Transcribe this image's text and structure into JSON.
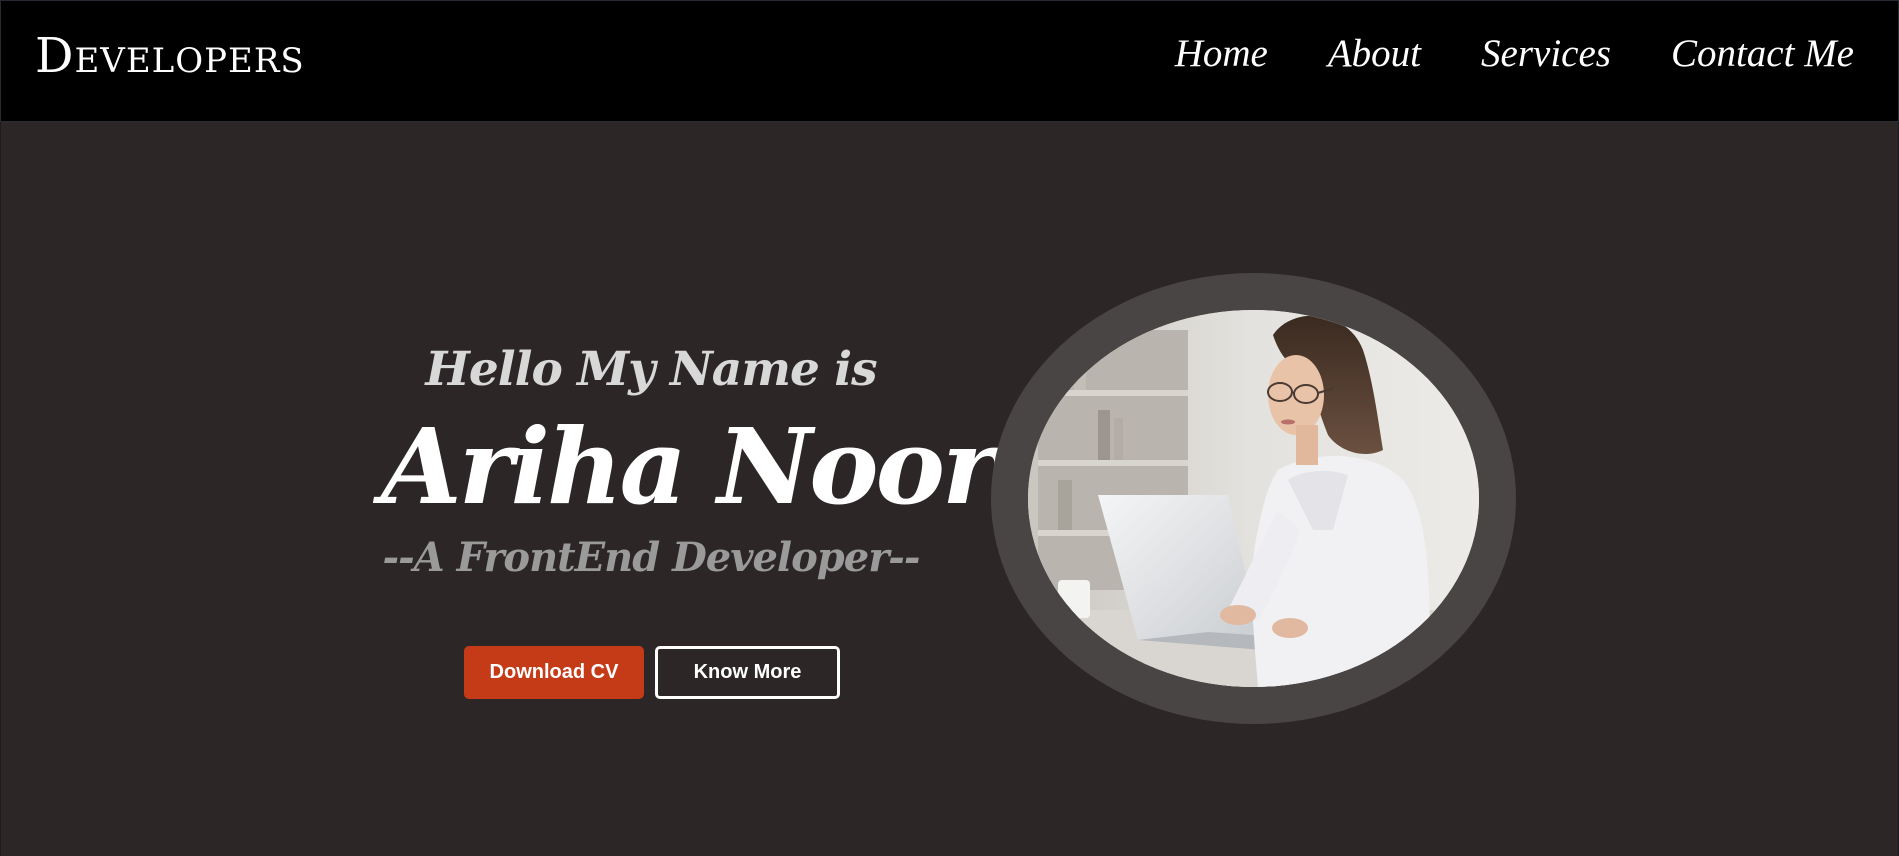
{
  "nav": {
    "brand": "Developers",
    "links": [
      "Home",
      "About",
      "Services",
      "Contact Me"
    ]
  },
  "hero": {
    "greeting": "Hello My Name is",
    "name": "Ariha Noor",
    "role": "--A FrontEnd Developer--",
    "buttons": {
      "download": "Download CV",
      "know_more": "Know More"
    }
  },
  "colors": {
    "navbar_bg": "#000000",
    "hero_bg": "#2c2627",
    "accent": "#c53a17",
    "ring": "#494545"
  },
  "images": {
    "profile": "woman-working-on-laptop-photo"
  }
}
